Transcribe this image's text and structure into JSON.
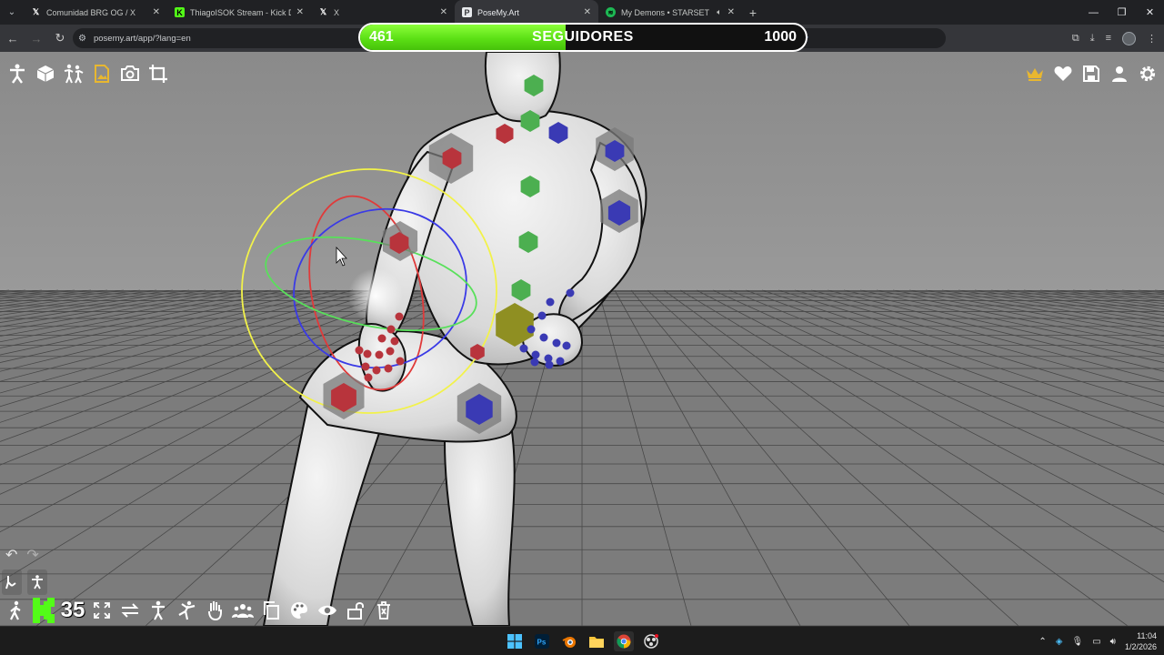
{
  "browser": {
    "tabs": [
      {
        "title": "Comunidad BRG OG / X",
        "favicon": "x-logo-icon",
        "active": false
      },
      {
        "title": "ThiagoISOK Stream - Kick Dashb",
        "favicon": "kick-logo-icon",
        "active": false
      },
      {
        "title": "X",
        "favicon": "x-logo-icon",
        "active": false
      },
      {
        "title": "PoseMy.Art",
        "favicon": "posemy-art-icon",
        "active": true
      },
      {
        "title": "My Demons • STARSET",
        "favicon": "spotify-icon",
        "active": false,
        "audio": true
      }
    ],
    "url": "posemy.art/app/?lang=en"
  },
  "goal": {
    "current": "461",
    "label": "SEGUIDORES",
    "target": "1000",
    "fill_color": "#5ce015"
  },
  "app": {
    "top_left_tools": [
      "pose-figure-icon",
      "cube-icon",
      "multi-figure-icon",
      "image-icon",
      "camera-icon",
      "crop-icon"
    ],
    "top_right_tools": [
      "crown-icon",
      "heart-icon",
      "save-icon",
      "user-icon",
      "gear-icon"
    ],
    "bottom_tools": [
      "fullscreen-icon",
      "swap-icon",
      "figure-icon",
      "kick-pose-icon",
      "hand-icon",
      "group-icon",
      "copy-icon",
      "palette-icon",
      "eye-icon",
      "unlock-icon",
      "trash-icon"
    ],
    "accent_color": "#e8b730"
  },
  "stream": {
    "kick_count": "35"
  },
  "taskbar": {
    "apps": [
      "windows-start-icon",
      "photoshop-icon",
      "blender-icon",
      "file-explorer-icon",
      "chrome-icon",
      "obs-icon"
    ],
    "time": "11:04",
    "date": "1/2/2026"
  }
}
